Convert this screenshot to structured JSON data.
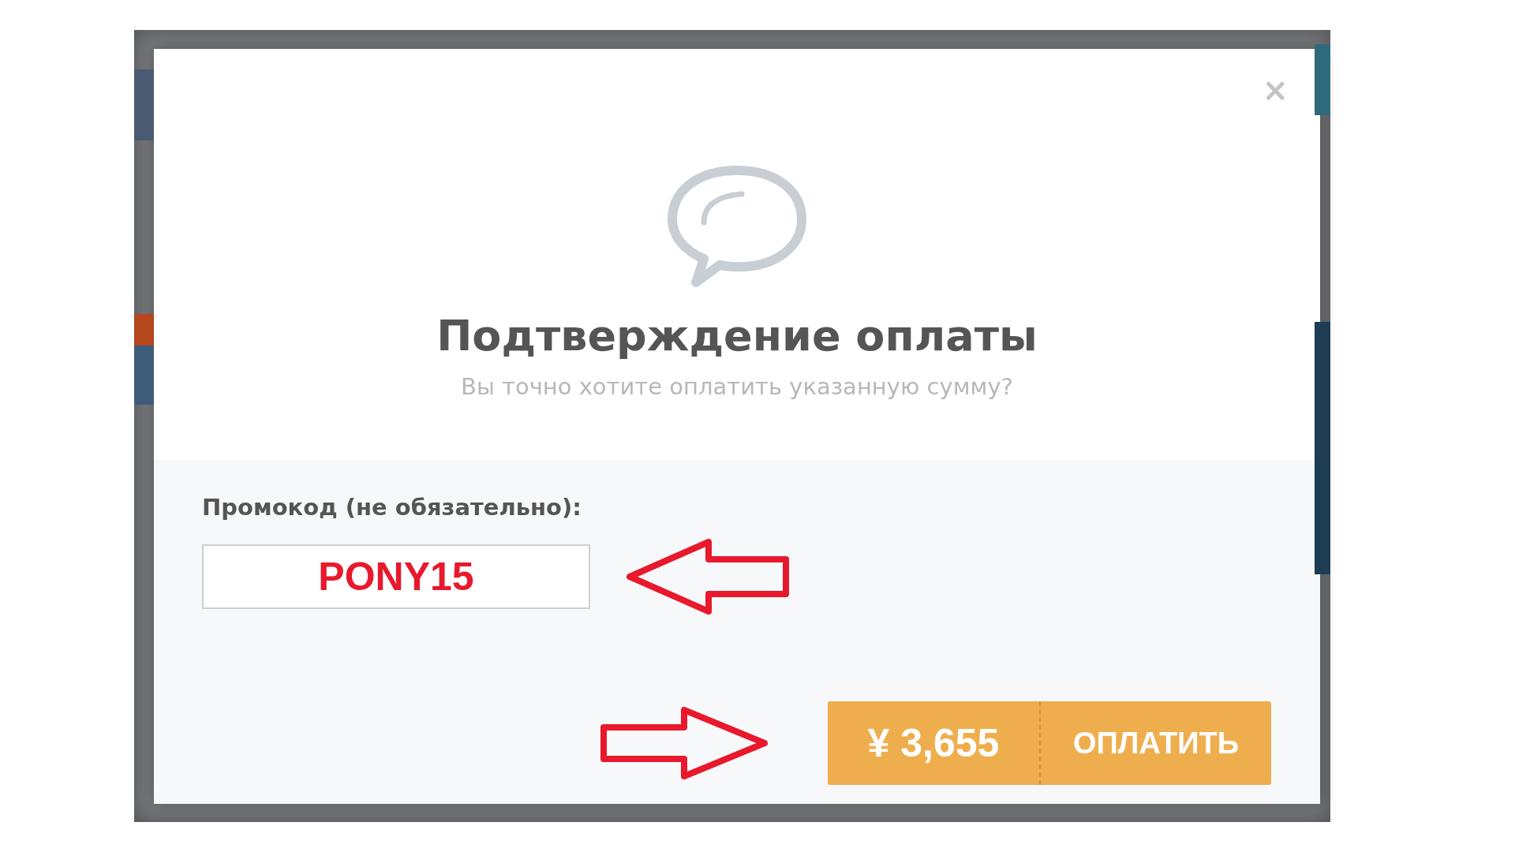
{
  "modal": {
    "close": "×",
    "title": "Подтверждение оплаты",
    "subtitle": "Вы точно хотите оплатить указанную сумму?"
  },
  "promo": {
    "label": "Промокод (не обязательно):",
    "value": "PONY15"
  },
  "pay_button": {
    "amount": "¥ 3,655",
    "label": "ОПЛАТИТЬ"
  }
}
